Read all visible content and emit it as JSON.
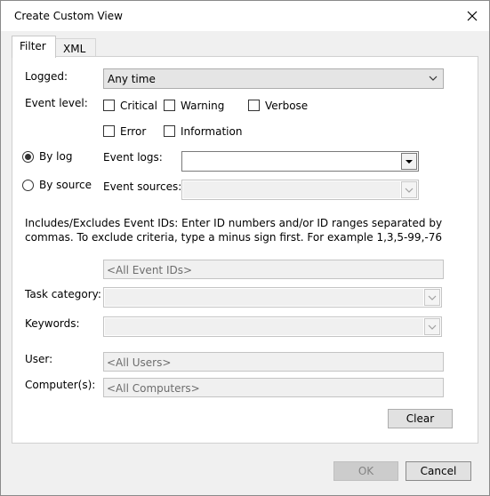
{
  "window": {
    "title": "Create Custom View"
  },
  "tabs": [
    {
      "label": "Filter",
      "active": true
    },
    {
      "label": "XML",
      "active": false
    }
  ],
  "filter": {
    "logged_label": "Logged:",
    "logged_value": "Any time",
    "event_level_label": "Event level:",
    "levels": [
      {
        "label": "Critical",
        "checked": false
      },
      {
        "label": "Warning",
        "checked": false
      },
      {
        "label": "Verbose",
        "checked": false
      },
      {
        "label": "Error",
        "checked": false
      },
      {
        "label": "Information",
        "checked": false
      }
    ],
    "by_log_label": "By log",
    "by_source_label": "By source",
    "event_logs_label": "Event logs:",
    "event_logs_value": "",
    "event_sources_label": "Event sources:",
    "event_sources_value": "",
    "ids_description": "Includes/Excludes Event IDs: Enter ID numbers and/or ID ranges separated by commas. To exclude criteria, type a minus sign first. For example 1,3,5-99,-76",
    "event_ids_placeholder": "<All Event IDs>",
    "task_category_label": "Task category:",
    "keywords_label": "Keywords:",
    "user_label": "User:",
    "user_placeholder": "<All Users>",
    "computers_label": "Computer(s):",
    "computers_placeholder": "<All Computers>",
    "clear_label": "Clear"
  },
  "footer": {
    "ok_label": "OK",
    "cancel_label": "Cancel"
  },
  "colors": {
    "accent": "#1e5aa8",
    "dialog_bg": "#f0f0f0"
  }
}
